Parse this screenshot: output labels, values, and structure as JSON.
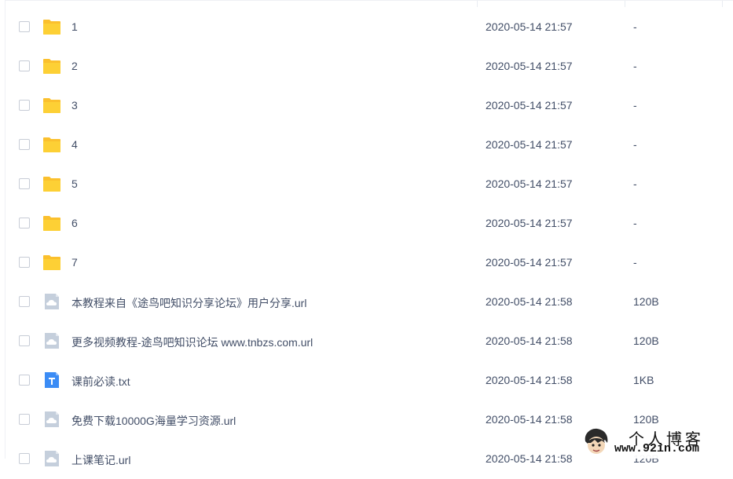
{
  "files": [
    {
      "name": "1",
      "type": "folder",
      "date": "2020-05-14 21:57",
      "size": "-"
    },
    {
      "name": "2",
      "type": "folder",
      "date": "2020-05-14 21:57",
      "size": "-"
    },
    {
      "name": "3",
      "type": "folder",
      "date": "2020-05-14 21:57",
      "size": "-"
    },
    {
      "name": "4",
      "type": "folder",
      "date": "2020-05-14 21:57",
      "size": "-"
    },
    {
      "name": "5",
      "type": "folder",
      "date": "2020-05-14 21:57",
      "size": "-"
    },
    {
      "name": "6",
      "type": "folder",
      "date": "2020-05-14 21:57",
      "size": "-"
    },
    {
      "name": "7",
      "type": "folder",
      "date": "2020-05-14 21:57",
      "size": "-"
    },
    {
      "name": "本教程来自《途鸟吧知识分享论坛》用户分享.url",
      "type": "url",
      "date": "2020-05-14 21:58",
      "size": "120B"
    },
    {
      "name": "更多视频教程-途鸟吧知识论坛 www.tnbzs.com.url",
      "type": "url",
      "date": "2020-05-14 21:58",
      "size": "120B"
    },
    {
      "name": "课前必读.txt",
      "type": "txt",
      "date": "2020-05-14 21:58",
      "size": "1KB"
    },
    {
      "name": "免费下载10000G海量学习资源.url",
      "type": "url",
      "date": "2020-05-14 21:58",
      "size": "120B"
    },
    {
      "name": "上课笔记.url",
      "type": "url",
      "date": "2020-05-14 21:58",
      "size": "120B"
    }
  ],
  "icons": {
    "folder": "folder-icon",
    "url": "url-file-icon",
    "txt": "text-file-icon"
  },
  "colors": {
    "folder": "#fbc02d",
    "url_file": "#c5cfdc",
    "txt_file": "#3b8cf5",
    "text": "#424e67"
  },
  "watermark": {
    "title": "个人博客",
    "url": "www.92in.com"
  }
}
